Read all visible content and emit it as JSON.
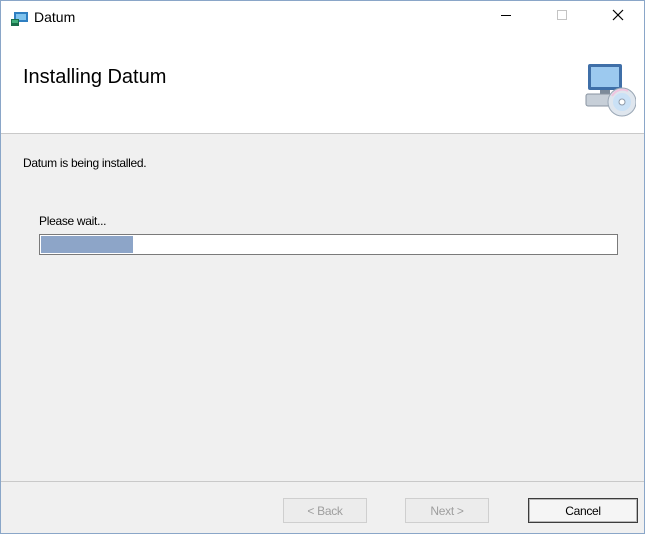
{
  "window": {
    "title": "Datum",
    "icon": "installer-app-icon",
    "controls": [
      "minimize-icon",
      "maximize-icon",
      "close-icon"
    ]
  },
  "header": {
    "title": "Installing Datum",
    "icon": "computer-cd-icon"
  },
  "main": {
    "status_text": "Datum is being installed.",
    "wait_text": "Please wait...",
    "progress_fraction": 0.16
  },
  "buttons": {
    "back": "< Back",
    "next": "Next >",
    "cancel": "Cancel"
  },
  "colors": {
    "progress_fill": "#8da5c8",
    "header_bg": "#ffffff",
    "body_bg": "#f0f0f0"
  }
}
